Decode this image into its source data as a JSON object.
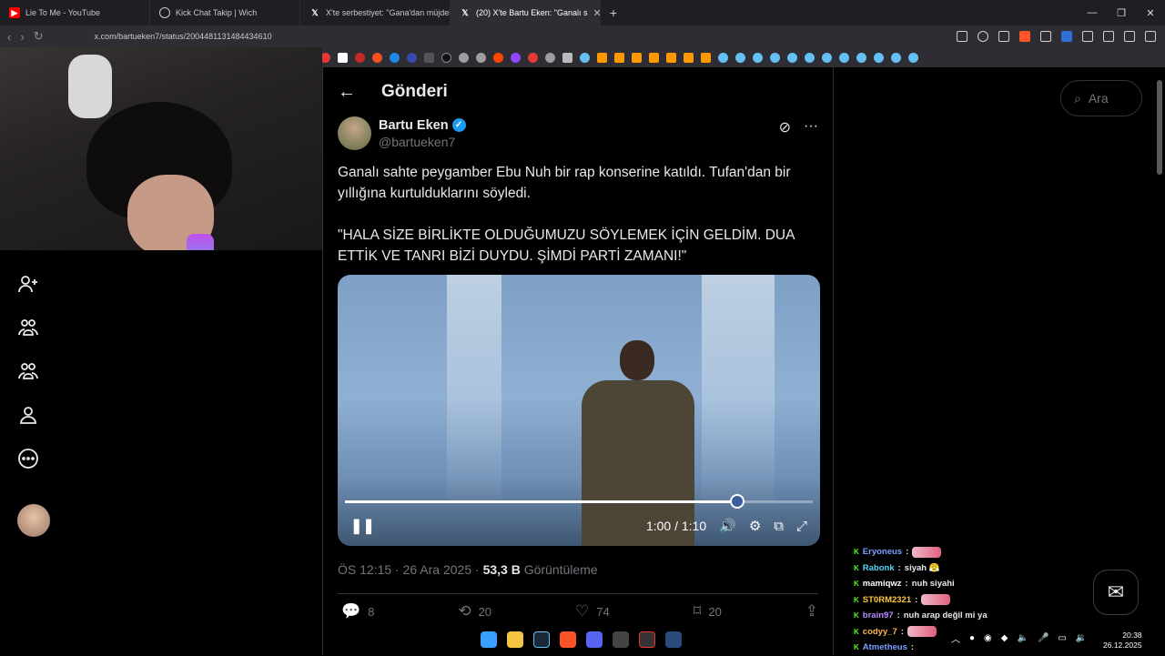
{
  "browser": {
    "tabs": [
      {
        "title": "Lie To Me - YouTube",
        "icon": "youtube-icon",
        "active": false
      },
      {
        "title": "Kick Chat Takip | Wich",
        "icon": "globe-icon",
        "active": false
      },
      {
        "title": "X'te serbestiyet: \"Gana'dan müjdeli h",
        "icon": "x-icon",
        "active": false
      },
      {
        "title": "(20) X'te Bartu Eken: \"Ganalı s",
        "icon": "x-icon",
        "active": true
      }
    ],
    "url": "x.com/bartueken7/status/2004481131484434610",
    "new_tab": "+"
  },
  "page": {
    "title": "Gönderi",
    "search_placeholder": "Ara"
  },
  "post": {
    "author_name": "Bartu Eken",
    "author_handle": "@bartueken7",
    "text": "Ganalı sahte peygamber Ebu Nuh bir rap konserine katıldı. Tufan'dan bir yıllığına kurtulduklarını söyledi.\n\n\"HALA SİZE BİRLİKTE OLDUĞUMUZU SÖYLEMEK İÇİN GELDİM.  DUA ETTİK VE TANRI BİZİ DUYDU. ŞİMDİ PARTİ ZAMANI!\"",
    "timestamp": "ÖS 12:15 · 26 Ara 2025",
    "views": "53,3 B",
    "views_label": "Görüntüleme",
    "replies": "8",
    "reposts": "20",
    "likes": "74",
    "bookmarks": "20"
  },
  "video": {
    "time": "1:00 / 1:10",
    "progress": 0.838
  },
  "chat": [
    {
      "user": "Eryoneus",
      "msg": "",
      "emote": true,
      "color": "#7aa0ff"
    },
    {
      "user": "Rabonk",
      "msg": "siyah 😤",
      "emote": false,
      "color": "#55d6ff"
    },
    {
      "user": "mamiqwz",
      "msg": "nuh siyahi",
      "emote": false,
      "color": "#ffffff"
    },
    {
      "user": "ST0RM2321",
      "msg": "",
      "emote": true,
      "color": "#ffc83d"
    },
    {
      "user": "brain97",
      "msg": "nuh arap değil mi ya",
      "emote": false,
      "color": "#b98cff"
    },
    {
      "user": "codyy_7",
      "msg": "",
      "emote": true,
      "color": "#ffb347"
    },
    {
      "user": "Atmetheus",
      "msg": "",
      "emote": false,
      "color": "#7aa0ff"
    }
  ],
  "system": {
    "time": "20:38",
    "date": "26.12.2025"
  }
}
